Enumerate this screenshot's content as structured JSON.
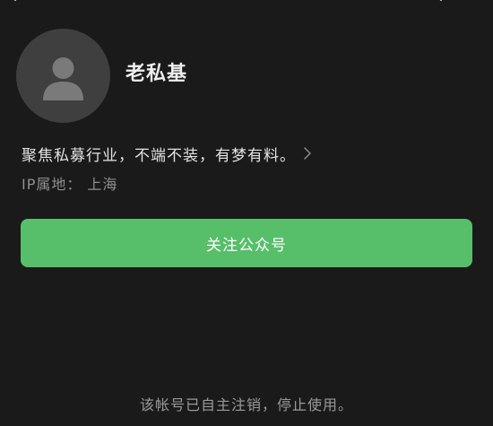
{
  "account": {
    "name": "老私基",
    "intro": "聚焦私募行业，不端不装，有梦有料。",
    "ip_label": "IP属地：",
    "ip_value": "上海",
    "avatar_icon": "default-avatar-icon"
  },
  "actions": {
    "follow_label": "关注公众号"
  },
  "status": {
    "message": "该帐号已自主注销，停止使用。"
  },
  "colors": {
    "background": "#1a1a1a",
    "follow_button": "#57be6a",
    "avatar_bg": "#3f3f3f",
    "muted_text": "#8f8f8f"
  },
  "icons": {
    "back": "back-arrow-icon",
    "close": "close-icon",
    "intro_more": "chevron-right-icon"
  }
}
